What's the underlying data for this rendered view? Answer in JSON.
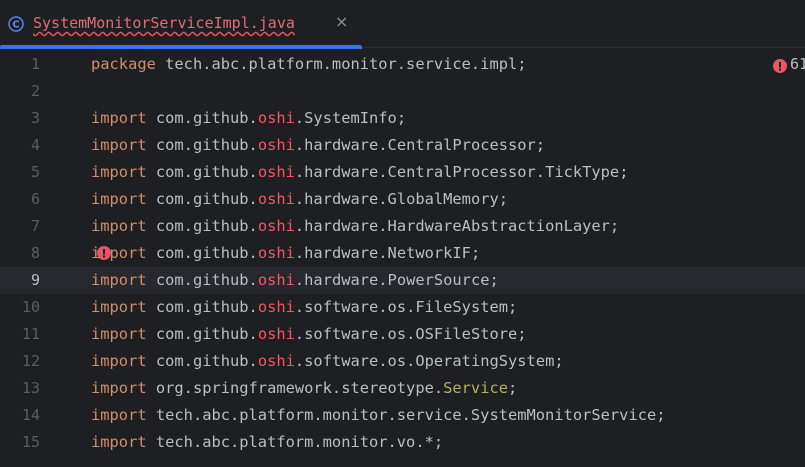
{
  "tab": {
    "title": "SystemMonitorServiceImpl.java",
    "close": "×",
    "icon": "class-c-icon"
  },
  "editor": {
    "current_line": 9,
    "error_count": "61",
    "lines": [
      {
        "n": "1",
        "parts": [
          [
            "kw",
            "package"
          ],
          [
            "pl",
            " tech.abc.platform.monitor.service.impl;"
          ]
        ]
      },
      {
        "n": "2",
        "parts": []
      },
      {
        "n": "3",
        "parts": [
          [
            "kw",
            "import"
          ],
          [
            "pl",
            " com.github."
          ],
          [
            "red",
            "oshi"
          ],
          [
            "pl",
            ".SystemInfo;"
          ]
        ]
      },
      {
        "n": "4",
        "parts": [
          [
            "kw",
            "import"
          ],
          [
            "pl",
            " com.github."
          ],
          [
            "red",
            "oshi"
          ],
          [
            "pl",
            ".hardware.CentralProcessor;"
          ]
        ]
      },
      {
        "n": "5",
        "parts": [
          [
            "kw",
            "import"
          ],
          [
            "pl",
            " com.github."
          ],
          [
            "red",
            "oshi"
          ],
          [
            "pl",
            ".hardware.CentralProcessor.TickType;"
          ]
        ]
      },
      {
        "n": "6",
        "parts": [
          [
            "kw",
            "import"
          ],
          [
            "pl",
            " com.github."
          ],
          [
            "red",
            "oshi"
          ],
          [
            "pl",
            ".hardware.GlobalMemory;"
          ]
        ]
      },
      {
        "n": "7",
        "parts": [
          [
            "kw",
            "import"
          ],
          [
            "pl",
            " com.github."
          ],
          [
            "red",
            "oshi"
          ],
          [
            "pl",
            ".hardware.HardwareAbstractionLayer;"
          ]
        ]
      },
      {
        "n": "8",
        "parts": [
          [
            "kw",
            "import"
          ],
          [
            "pl",
            " com.github."
          ],
          [
            "red",
            "oshi"
          ],
          [
            "pl",
            ".hardware.NetworkIF;"
          ]
        ]
      },
      {
        "n": "9",
        "parts": [
          [
            "kw",
            "import"
          ],
          [
            "pl",
            " com.github."
          ],
          [
            "red",
            "oshi"
          ],
          [
            "pl",
            ".hardware.PowerSource;"
          ]
        ]
      },
      {
        "n": "10",
        "parts": [
          [
            "kw",
            "import"
          ],
          [
            "pl",
            " com.github."
          ],
          [
            "red",
            "oshi"
          ],
          [
            "pl",
            ".software.os.FileSystem;"
          ]
        ]
      },
      {
        "n": "11",
        "parts": [
          [
            "kw",
            "import"
          ],
          [
            "pl",
            " com.github."
          ],
          [
            "red",
            "oshi"
          ],
          [
            "pl",
            ".software.os.OSFileStore;"
          ]
        ]
      },
      {
        "n": "12",
        "parts": [
          [
            "kw",
            "import"
          ],
          [
            "pl",
            " com.github."
          ],
          [
            "red",
            "oshi"
          ],
          [
            "pl",
            ".software.os.OperatingSystem;"
          ]
        ]
      },
      {
        "n": "13",
        "parts": [
          [
            "kw",
            "import"
          ],
          [
            "pl",
            " org.springframework.stereotype."
          ],
          [
            "ann",
            "Service"
          ],
          [
            "pl",
            ";"
          ]
        ]
      },
      {
        "n": "14",
        "parts": [
          [
            "kw",
            "import"
          ],
          [
            "pl",
            " tech.abc.platform.monitor.service.SystemMonitorService;"
          ]
        ]
      },
      {
        "n": "15",
        "parts": [
          [
            "kw",
            "import"
          ],
          [
            "pl",
            " tech.abc.platform.monitor.vo.*;"
          ]
        ]
      }
    ]
  },
  "colors": {
    "background": "#1e1f22",
    "keyword": "#cf8e6d",
    "error_text": "#f75464",
    "annotation": "#b3ae60",
    "tab_accent": "#3574f0",
    "error_icon": "#e55765"
  }
}
